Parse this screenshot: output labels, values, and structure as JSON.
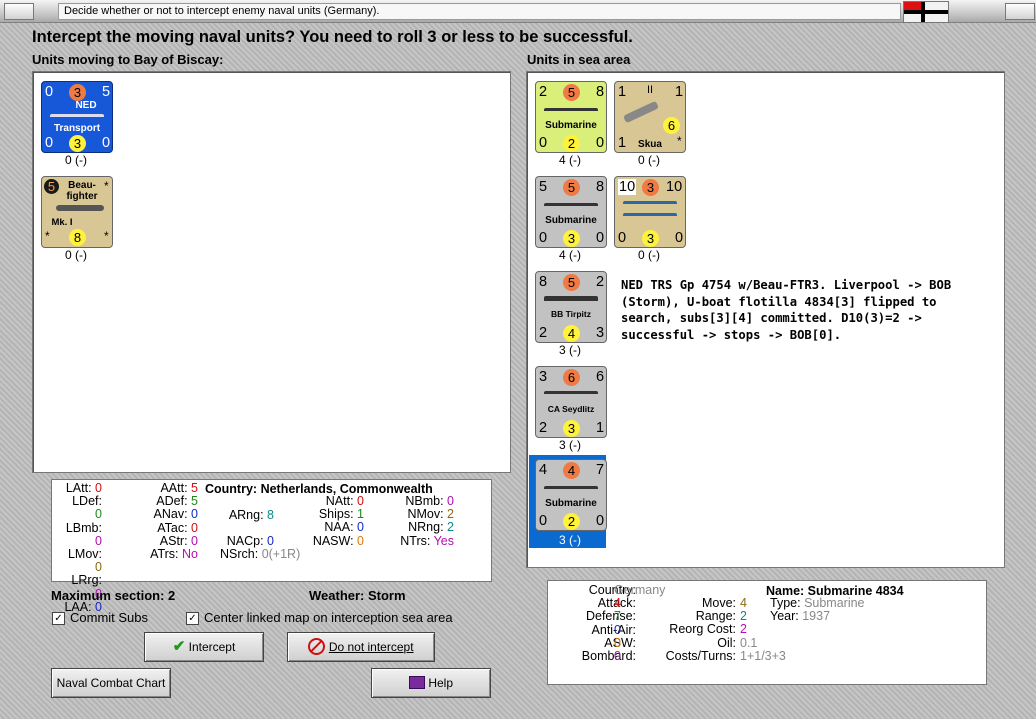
{
  "window": {
    "title": "Decide whether or not to intercept enemy naval units (Germany)."
  },
  "heading": "Intercept the moving naval units?  You need to roll 3 or less to be successful.",
  "left_panel": {
    "label": "Units moving to Bay of Biscay:",
    "units": [
      {
        "name": "Transport",
        "tl": "0",
        "tm": "3",
        "tr": "5",
        "flag": "NED",
        "bl": "0",
        "bm": "3",
        "br": "0",
        "caption": "0 (-)"
      },
      {
        "name_line1": "Beau-",
        "name_line2": "fighter",
        "name_line3": "Mk. I",
        "tl": "5",
        "tr": "*",
        "bl": "*",
        "bm": "8",
        "br": "*",
        "caption": "0 (-)"
      }
    ]
  },
  "right_panel": {
    "label": "Units in sea area",
    "units": [
      {
        "name": "Submarine",
        "tl": "2",
        "tm": "5",
        "tr": "8",
        "bl": "0",
        "bm": "2",
        "br": "0",
        "caption": "4 (-)"
      },
      {
        "name": "Skua",
        "tl": "1",
        "tm": "II",
        "tr": "1",
        "mid": "6",
        "bl": "1",
        "br": "*",
        "caption": "0 (-)"
      },
      {
        "name": "Submarine",
        "tl": "5",
        "tm": "5",
        "tr": "8",
        "bl": "0",
        "bm": "3",
        "br": "0",
        "caption": "4 (-)"
      },
      {
        "name": "",
        "tl": "10",
        "tm": "3",
        "tr": "10",
        "bl": "0",
        "bm": "3",
        "br": "0",
        "caption": "0 (-)"
      },
      {
        "name": "BB Tirpitz",
        "tl": "8",
        "tm": "5",
        "tr": "2",
        "bl": "2",
        "bm": "4",
        "br": "3",
        "caption": "3 (-)"
      },
      {
        "name": "CA Seydlitz",
        "tl": "3",
        "tm": "6",
        "tr": "6",
        "bl": "2",
        "bm": "3",
        "br": "1",
        "caption": "3 (-)"
      },
      {
        "name": "Submarine",
        "tl": "4",
        "tm": "4",
        "tr": "7",
        "bl": "0",
        "bm": "2",
        "br": "0",
        "caption": "3 (-)"
      }
    ],
    "message": "NED TRS Gp 4754 w/Beau-FTR3.  Liverpool -> BOB (Storm), U-boat flotilla 4834[3] flipped to search, subs[3][4] committed.  D10(3)=2 -> successful -> stops -> BOB[0]."
  },
  "left_stats": {
    "country_label": "Country:",
    "country_value": "Netherlands, Commonwealth",
    "items": [
      {
        "k": "LAtt:",
        "v": "0"
      },
      {
        "k": "LDef:",
        "v": "0"
      },
      {
        "k": "LBmb:",
        "v": "0"
      },
      {
        "k": "LMov:",
        "v": "0"
      },
      {
        "k": "LRrg:",
        "v": "0"
      },
      {
        "k": "LAA:",
        "v": "0"
      },
      {
        "k": "AAtt:",
        "v": "5"
      },
      {
        "k": "ADef:",
        "v": "5"
      },
      {
        "k": "ANav:",
        "v": "0"
      },
      {
        "k": "ATac:",
        "v": "0"
      },
      {
        "k": "AStr:",
        "v": "0"
      },
      {
        "k": "ATrs:",
        "v": "No"
      },
      {
        "k": "ARng:",
        "v": "8"
      },
      {
        "k": "NACp:",
        "v": "0"
      },
      {
        "k": "NSrch:",
        "v": "0(+1R)"
      },
      {
        "k": "NAtt:",
        "v": "0"
      },
      {
        "k": "Ships:",
        "v": "1"
      },
      {
        "k": "NAA:",
        "v": "0"
      },
      {
        "k": "NASW:",
        "v": "0"
      },
      {
        "k": "NBmb:",
        "v": "0"
      },
      {
        "k": "NMov:",
        "v": "2"
      },
      {
        "k": "NRng:",
        "v": "2"
      },
      {
        "k": "NTrs:",
        "v": "Yes"
      }
    ]
  },
  "info": {
    "max_section": "Maximum section: 2",
    "weather": "Weather:  Storm",
    "commit_subs": "Commit Subs",
    "center_map": "Center linked map on interception sea area"
  },
  "buttons": {
    "intercept": "Intercept",
    "do_not_intercept": "Do not intercept",
    "naval_chart": "Naval Combat Chart",
    "help": "Help"
  },
  "right_stats": {
    "country_k": "Country:",
    "country_v": "Germany",
    "attack_k": "Attack:",
    "attack_v": "4",
    "defense_k": "Defense:",
    "defense_v": "7",
    "aa_k": "Anti-Air:",
    "aa_v": "0",
    "asw_k": "ASW:",
    "asw_v": "0",
    "bombard_k": "Bombard:",
    "bombard_v": "0",
    "move_k": "Move:",
    "move_v": "4",
    "range_k": "Range:",
    "range_v": "2",
    "reorg_k": "Reorg Cost:",
    "reorg_v": "2",
    "oil_k": "Oil:",
    "oil_v": "0.1",
    "costs_k": "Costs/Turns:",
    "costs_v": "1+1/3+3",
    "name": "Name: Submarine 4834",
    "type_k": "Type:",
    "type_v": "Submarine",
    "year_k": "Year:",
    "year_v": "1937"
  }
}
